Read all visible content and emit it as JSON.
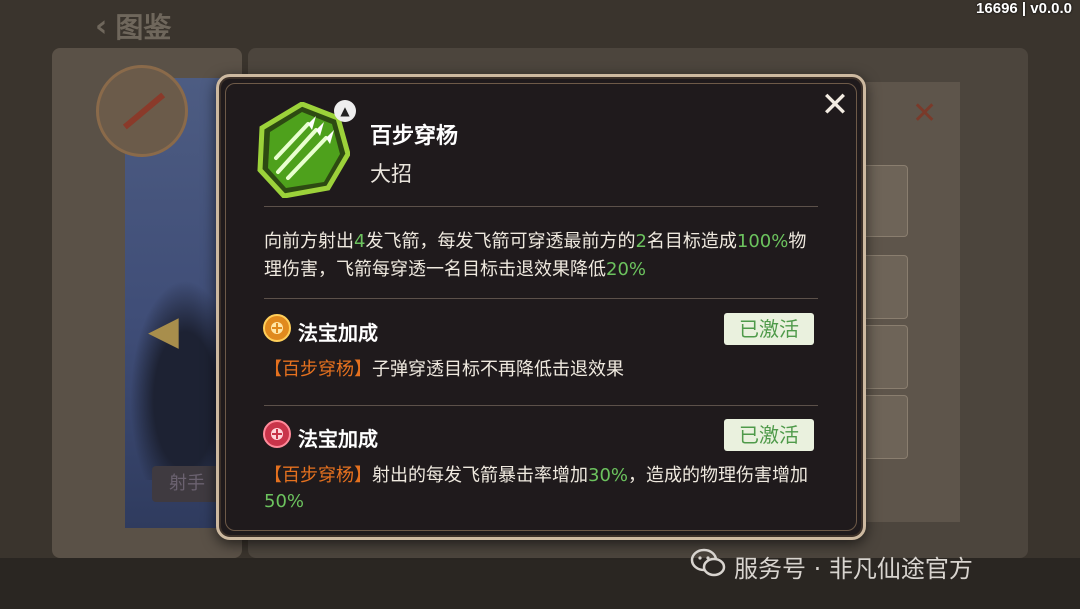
{
  "background": {
    "header_title": "图鉴",
    "left_tag": "射手"
  },
  "version_label": "16696 | v0.0.0",
  "skill": {
    "icon": "triple-arrow-icon",
    "name": "百步穿杨",
    "type": "大招",
    "description_parts": [
      {
        "text": "向前方射出",
        "hl": false
      },
      {
        "text": "4",
        "hl": true
      },
      {
        "text": "发飞箭，每发飞箭可穿透最前方的",
        "hl": false
      },
      {
        "text": "2",
        "hl": true
      },
      {
        "text": "名目标造成",
        "hl": false
      },
      {
        "text": "100%",
        "hl": true
      },
      {
        "text": "物理伤害，飞箭每穿透一名目标击退效果降低",
        "hl": false
      },
      {
        "text": "20%",
        "hl": true
      }
    ]
  },
  "bonuses": [
    {
      "icon": "treasure-gold-icon",
      "title": "法宝加成",
      "status": "已激活",
      "tag": "【百步穿杨】",
      "text_parts": [
        {
          "text": "子弹穿透目标不再降低击退效果",
          "hl": false
        }
      ]
    },
    {
      "icon": "treasure-red-icon",
      "title": "法宝加成",
      "status": "已激活",
      "tag": "【百步穿杨】",
      "text_parts": [
        {
          "text": "射出的每发飞箭暴击率增加",
          "hl": false
        },
        {
          "text": "30%",
          "hl": true
        },
        {
          "text": "，造成的物理伤害增加",
          "hl": false
        },
        {
          "text": "50%",
          "hl": true
        }
      ]
    }
  ],
  "watermark": "服务号 · 非凡仙途官方",
  "colors": {
    "highlight_green": "#6cc35e",
    "highlight_orange": "#e5711f",
    "badge_bg": "#eaf1de"
  }
}
